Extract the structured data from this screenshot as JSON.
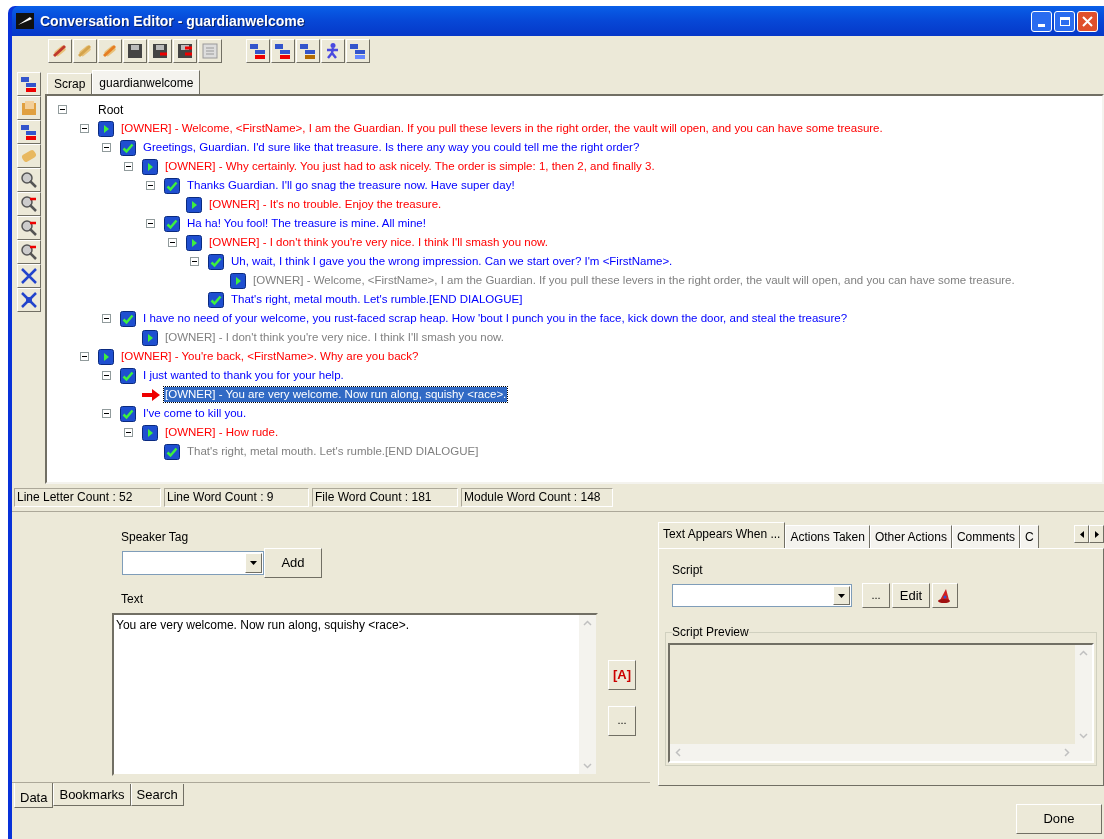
{
  "window": {
    "title": "Conversation Editor - guardianwelcome"
  },
  "tabs": [
    {
      "label": "Scrap",
      "selected": false
    },
    {
      "label": "guardianwelcome",
      "selected": true
    }
  ],
  "tree": {
    "label": "Root",
    "expanded": true,
    "children": [
      {
        "kind": "npc",
        "link": false,
        "selected": false,
        "expanded": true,
        "text": "[OWNER] - Welcome, <FirstName>, I am the Guardian. If you pull these levers in the right order, the vault will open, and you can have some treasure.",
        "children": [
          {
            "kind": "pc",
            "link": false,
            "selected": false,
            "expanded": true,
            "text": "Greetings, Guardian. I'd sure like that treasure. Is there any way you could tell me the right order?",
            "children": [
              {
                "kind": "npc",
                "link": false,
                "selected": false,
                "expanded": true,
                "text": "[OWNER] - Why certainly. You just had to ask nicely. The order is simple: 1, then 2, and finally 3.",
                "children": [
                  {
                    "kind": "pc",
                    "link": false,
                    "selected": false,
                    "expanded": true,
                    "text": "Thanks Guardian. I'll go snag the treasure now. Have super day!",
                    "children": [
                      {
                        "kind": "npc",
                        "link": false,
                        "selected": false,
                        "text": "[OWNER] - It's no trouble. Enjoy the treasure."
                      }
                    ]
                  },
                  {
                    "kind": "pc",
                    "link": false,
                    "selected": false,
                    "expanded": true,
                    "text": "Ha ha! You fool! The treasure is mine. All mine!",
                    "children": [
                      {
                        "kind": "npc",
                        "link": false,
                        "selected": false,
                        "expanded": true,
                        "text": "[OWNER] - I don't think you're very nice. I think I'll smash you now.",
                        "children": [
                          {
                            "kind": "pc",
                            "link": false,
                            "selected": false,
                            "expanded": true,
                            "text": "Uh, wait, I think I gave you the wrong impression. Can we start over? I'm <FirstName>.",
                            "children": [
                              {
                                "kind": "npc",
                                "link": true,
                                "selected": false,
                                "text": "[OWNER] - Welcome, <FirstName>, I am the Guardian. If you pull these levers in the right order, the vault will open, and you can have some treasure."
                              }
                            ]
                          },
                          {
                            "kind": "pc",
                            "link": false,
                            "selected": false,
                            "text": "That's right, metal mouth. Let's rumble.[END DIALOGUE]"
                          }
                        ]
                      }
                    ]
                  }
                ]
              }
            ]
          },
          {
            "kind": "pc",
            "link": false,
            "selected": false,
            "expanded": true,
            "text": "I have no need of your welcome, you rust-faced scrap heap. How 'bout I punch you in the face, kick down the door, and steal the treasure?",
            "children": [
              {
                "kind": "npc",
                "link": true,
                "selected": false,
                "text": "[OWNER] - I don't think you're very nice. I think I'll smash you now."
              }
            ]
          }
        ]
      },
      {
        "kind": "npc",
        "link": false,
        "selected": false,
        "expanded": true,
        "text": "[OWNER] - You're back, <FirstName>. Why are you back?",
        "children": [
          {
            "kind": "pc",
            "link": false,
            "selected": false,
            "expanded": true,
            "text": "I just wanted to thank you for your help.",
            "children": [
              {
                "kind": "npc",
                "link": false,
                "selected": true,
                "text": "[OWNER] - You are very welcome. Now run along, squishy <race>."
              }
            ]
          },
          {
            "kind": "pc",
            "link": false,
            "selected": false,
            "expanded": true,
            "text": "I've come to kill you.",
            "children": [
              {
                "kind": "npc",
                "link": false,
                "selected": false,
                "expanded": true,
                "text": "[OWNER] - How rude.",
                "children": [
                  {
                    "kind": "pc",
                    "link": true,
                    "selected": false,
                    "text": "That's right, metal mouth. Let's rumble.[END DIALOGUE]"
                  }
                ]
              }
            ]
          }
        ]
      }
    ]
  },
  "status_bar": [
    "Line Letter Count : 52",
    "Line Word Count : 9",
    "File Word Count : 181",
    "Module Word Count : 148"
  ],
  "data_panel": {
    "speaker_tag_label": "Speaker Tag",
    "add_button": "Add",
    "text_label": "Text",
    "text_value": "You are very welcome. Now run along, squishy <race>.",
    "side_buttons": [
      "[A]",
      "..."
    ]
  },
  "property_tabs": [
    {
      "label": "Text Appears When ...",
      "selected": true
    },
    {
      "label": "Actions Taken",
      "selected": false
    },
    {
      "label": "Other Actions",
      "selected": false
    },
    {
      "label": "Comments",
      "selected": false
    },
    {
      "label": "C",
      "selected": false
    }
  ],
  "script": {
    "label": "Script",
    "browse_button": "...",
    "edit_button": "Edit",
    "preview_label": "Script Preview"
  },
  "bottom_tabs": [
    {
      "label": "Data",
      "selected": true
    },
    {
      "label": "Bookmarks",
      "selected": false
    },
    {
      "label": "Search",
      "selected": false
    }
  ],
  "done_button": "Done"
}
